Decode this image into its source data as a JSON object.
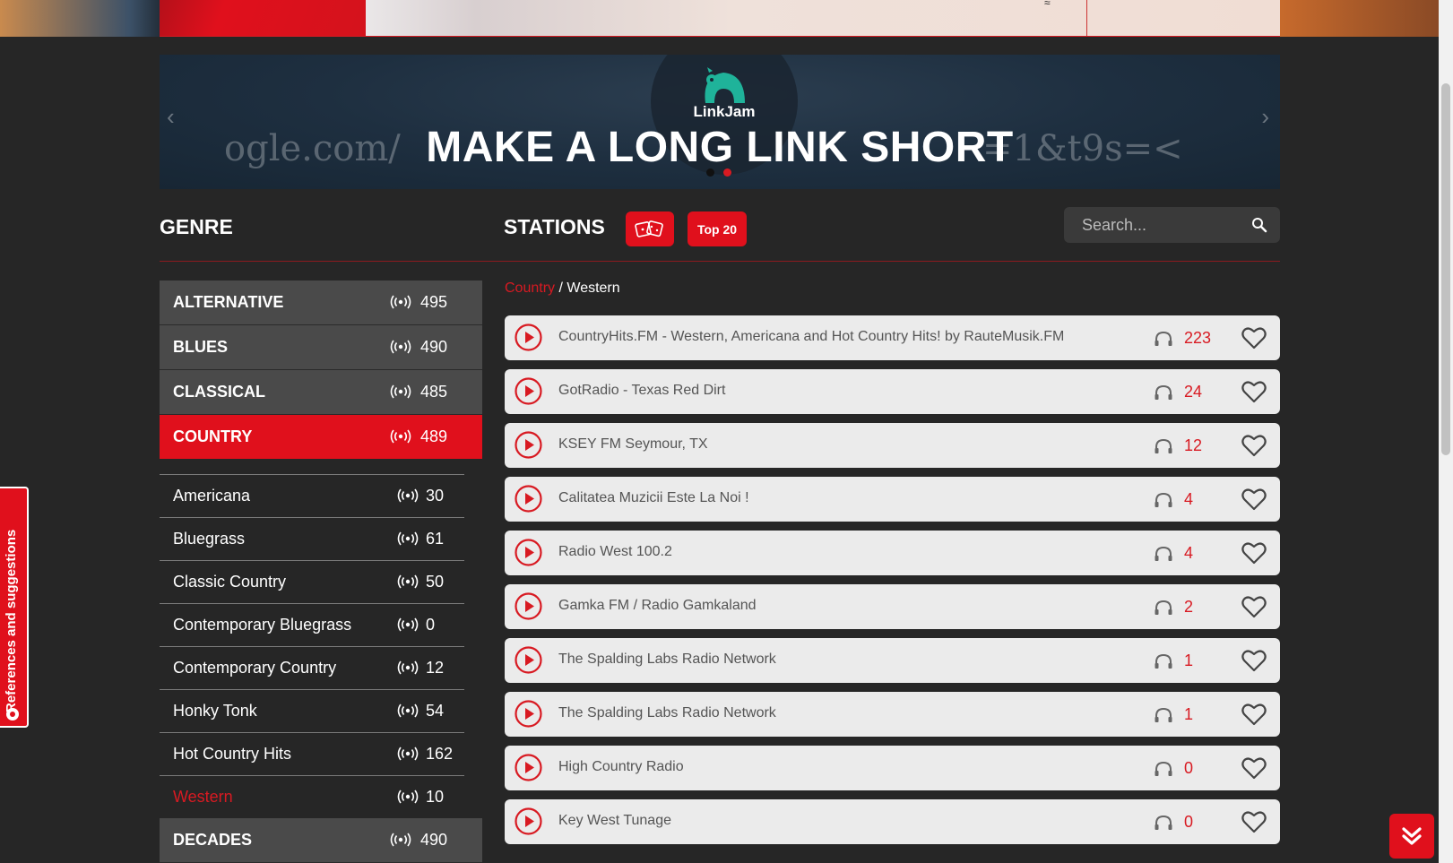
{
  "banner": {
    "logo_text": "LinkJam",
    "headline": "MAKE A LONG LINK SHORT",
    "deco_left": "ogle.com/",
    "deco_right": "=1&t9s=<"
  },
  "genre": {
    "title": "GENRE",
    "main_items": [
      {
        "label": "ALTERNATIVE",
        "count": "495"
      },
      {
        "label": "BLUES",
        "count": "490"
      },
      {
        "label": "CLASSICAL",
        "count": "485"
      },
      {
        "label": "COUNTRY",
        "count": "489"
      }
    ],
    "sub_items": [
      {
        "label": "Americana",
        "count": "30"
      },
      {
        "label": "Bluegrass",
        "count": "61"
      },
      {
        "label": "Classic Country",
        "count": "50"
      },
      {
        "label": "Contemporary Bluegrass",
        "count": "0"
      },
      {
        "label": "Contemporary Country",
        "count": "12"
      },
      {
        "label": "Honky Tonk",
        "count": "54"
      },
      {
        "label": "Hot Country Hits",
        "count": "162"
      },
      {
        "label": "Western",
        "count": "10"
      }
    ],
    "after_items": [
      {
        "label": "DECADES",
        "count": "490"
      }
    ]
  },
  "stations": {
    "title": "STATIONS",
    "top20_label": "Top 20",
    "search_placeholder": "Search...",
    "breadcrumb": {
      "parent": "Country",
      "separator": " / ",
      "current": "Western"
    },
    "items": [
      {
        "name": "CountryHits.FM - Western, Americana and Hot Country Hits! by RauteMusik.FM",
        "listeners": "223"
      },
      {
        "name": "GotRadio - Texas Red Dirt",
        "listeners": "24"
      },
      {
        "name": "KSEY FM Seymour, TX",
        "listeners": "12"
      },
      {
        "name": "Calitatea Muzicii Este La Noi !",
        "listeners": "4"
      },
      {
        "name": "Radio West 100.2",
        "listeners": "4"
      },
      {
        "name": "Gamka FM / Radio Gamkaland",
        "listeners": "2"
      },
      {
        "name": "The Spalding Labs Radio Network",
        "listeners": "1"
      },
      {
        "name": "The Spalding Labs Radio Network",
        "listeners": "1"
      },
      {
        "name": "High Country Radio",
        "listeners": "0"
      },
      {
        "name": "Key West Tunage",
        "listeners": "0"
      }
    ]
  },
  "side_tab": {
    "label": "References and suggestions"
  },
  "colors": {
    "accent": "#e0101c",
    "background": "#262626",
    "row": "#ebebeb"
  }
}
